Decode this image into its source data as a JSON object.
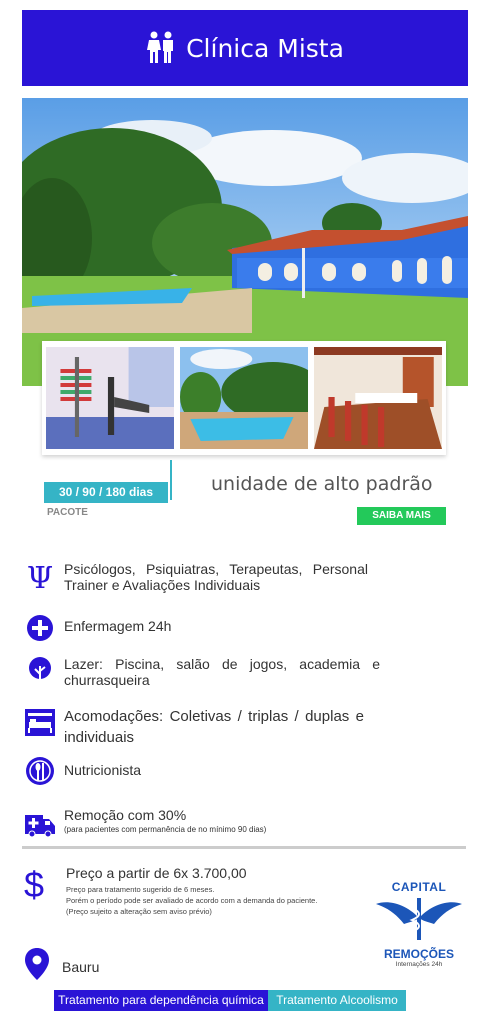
{
  "header": {
    "title": "Clínica Mista",
    "icon": "restroom-icon"
  },
  "package": {
    "badge": "30 / 90 / 180 dias",
    "label": "PACOTE"
  },
  "unit": {
    "text": "unidade de alto padrão",
    "cta": "SAIBA MAIS"
  },
  "features": [
    {
      "icon": "psi-icon",
      "text": "Psicólogos, Psiquiatras, Terapeutas, Personal Trainer e Avaliações Individuais"
    },
    {
      "icon": "plus-circle-icon",
      "text": "Enfermagem 24h"
    },
    {
      "icon": "tree-icon",
      "text": "Lazer: Piscina, salão de jogos, academia e churrasqueira"
    },
    {
      "icon": "bed-icon",
      "text": "Acomodações: Coletivas / triplas / duplas e individuais"
    },
    {
      "icon": "cutlery-icon",
      "text": "Nutricionista"
    },
    {
      "icon": "ambulance-icon",
      "text": "Remoção com 30%",
      "sub": "(para pacientes com permanência de no mínimo 90 dias)"
    }
  ],
  "price": {
    "symbol": "$",
    "main": "Preço a partir de 6x 3.700,00",
    "note1": "Preço para tratamento sugerido de 6 meses.",
    "note2": "Porém o período pode ser avaliado de acordo com a demanda do paciente.",
    "note3": "(Preço sujeito a alteração sem aviso prévio)"
  },
  "logo": {
    "line1": "CAPITAL",
    "line2": "REMOÇÕES",
    "line3": "Internações 24h"
  },
  "location": {
    "icon": "map-pin-icon",
    "city": "Bauru"
  },
  "tags": {
    "tag1": "Tratamento para dependência química",
    "tag2": "Tratamento Alcoolismo"
  },
  "colors": {
    "primary": "#2a14d6",
    "accent": "#35b4c6",
    "cta": "#23c95a"
  }
}
